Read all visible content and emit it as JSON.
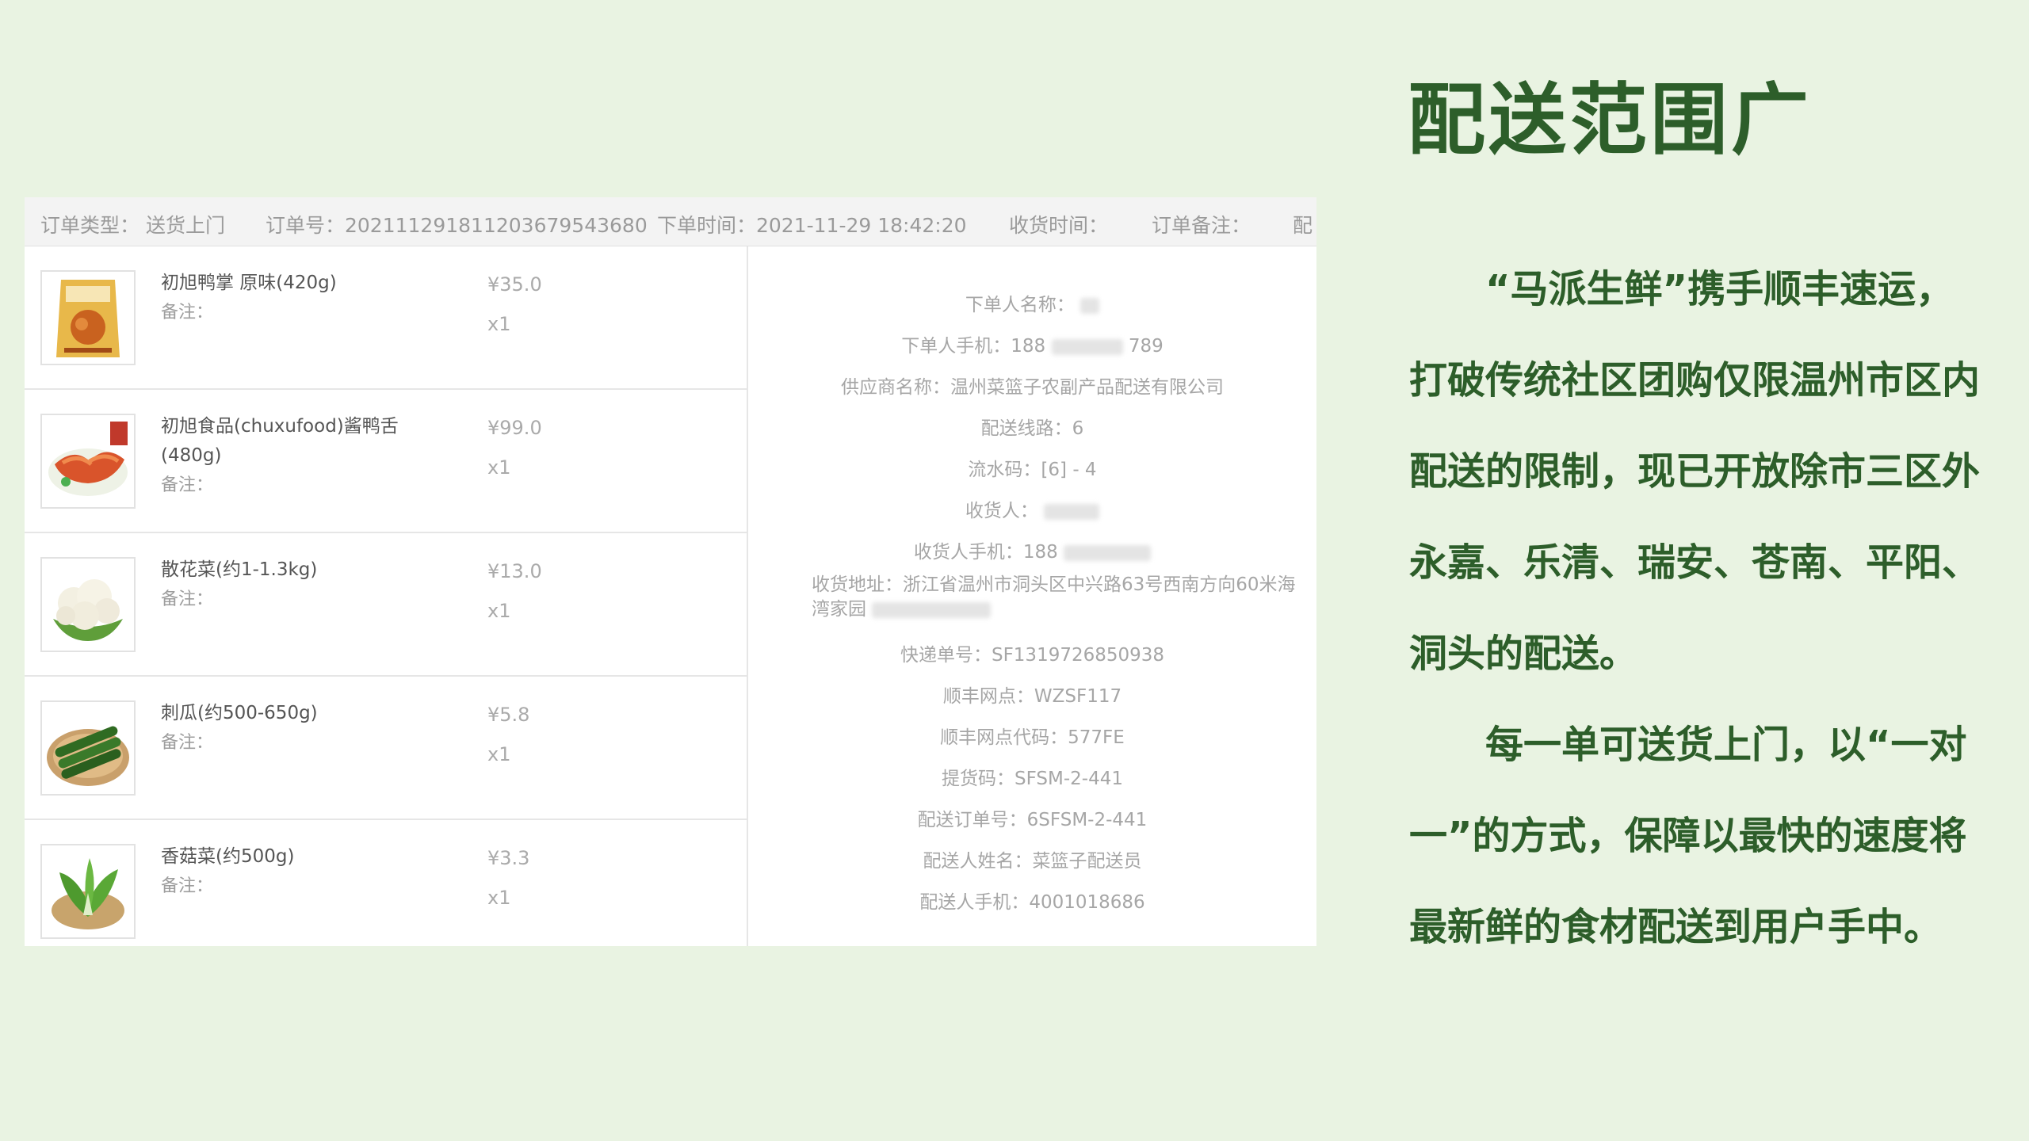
{
  "slide": {
    "title": "配送范围广",
    "paragraphs": [
      "“马派生鲜”携手顺丰速运，打破传统社区团购仅限温州市区内配送的限制，现已开放除市三区外永嘉、乐清、瑞安、苍南、平阳、洞头的配送。",
      "每一单可送货上门，以“一对一”的方式，保障以最快的速度将最新鲜的食材配送到用户手中。"
    ]
  },
  "order": {
    "header": {
      "type": "订单类型：  送货上门",
      "order_no": "订单号：202111291811203679543680",
      "order_time": "下单时间：2021-11-29 18:42:20",
      "receive_time": "收货时间：",
      "remark": "订单备注：",
      "truncated": "配"
    },
    "items": [
      {
        "name": "初旭鸭掌 原味(420g)",
        "note": "备注：",
        "price": "¥35.0",
        "qty": "x1",
        "icon": "duck-feet-package-icon"
      },
      {
        "name": "初旭食品(chuxufood)酱鸭舌(480g)",
        "note": "备注：",
        "price": "¥99.0",
        "qty": "x1",
        "icon": "duck-tongue-plate-icon"
      },
      {
        "name": "散花菜(约1-1.3kg)",
        "note": "备注：",
        "price": "¥13.0",
        "qty": "x1",
        "icon": "cauliflower-icon"
      },
      {
        "name": "刺瓜(约500-650g)",
        "note": "备注：",
        "price": "¥5.8",
        "qty": "x1",
        "icon": "cucumber-icon"
      },
      {
        "name": "香菇菜(约500g)",
        "note": "备注：",
        "price": "¥3.3",
        "qty": "x1",
        "icon": "bok-choy-icon"
      }
    ],
    "info": {
      "buyer_name": "下单人名称：",
      "buyer_phone": "下单人手机：188",
      "buyer_phone_tail": "789",
      "supplier": "供应商名称：温州菜篮子农副产品配送有限公司",
      "route": "配送线路：6",
      "serial": "流水码：[6] - 4",
      "receiver": "收货人：",
      "receiver_phone": "收货人手机：188",
      "address": "收货地址：浙江省温州市洞头区中兴路63号西南方向60米海湾家园",
      "express_no": "快递单号：SF1319726850938",
      "sf_site": "顺丰网点：WZSF117",
      "sf_site_code": "顺丰网点代码：577FE",
      "pickup_code": "提货码：SFSM-2-441",
      "delivery_order_no": "配送订单号：6SFSM-2-441",
      "courier_name": "配送人姓名：菜篮子配送员",
      "courier_phone": "配送人手机：4001018686"
    }
  }
}
